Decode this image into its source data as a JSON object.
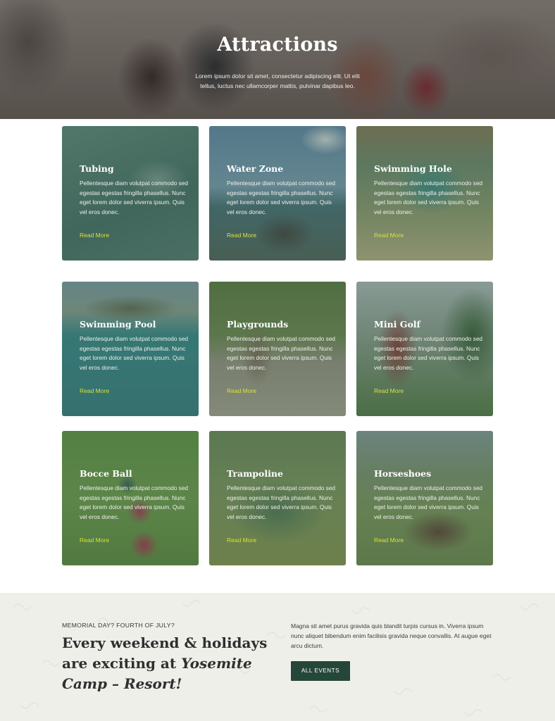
{
  "hero": {
    "title": "Attractions",
    "text": "Lorem ipsum dolor sit amet, consectetur adipiscing elit. Ut elit tellus, luctus nec ullamcorper mattis, pulvinar dapibus leo."
  },
  "cards": [
    {
      "title": "Tubing",
      "description": "Pellentesque diam volutpat commodo sed egestas egestas fringilla phasellus. Nunc eget lorem dolor sed viverra ipsum. Quis vel eros donec.",
      "link": "Read More"
    },
    {
      "title": "Water Zone",
      "description": "Pellentesque diam volutpat commodo sed egestas egestas fringilla phasellus. Nunc eget lorem dolor sed viverra ipsum. Quis vel eros donec.",
      "link": "Read More"
    },
    {
      "title": "Swimming Hole",
      "description": "Pellentesque diam volutpat commodo sed egestas egestas fringilla phasellus. Nunc eget lorem dolor sed viverra ipsum. Quis vel eros donec.",
      "link": "Read More"
    },
    {
      "title": "Swimming Pool",
      "description": "Pellentesque diam volutpat commodo sed egestas egestas fringilla phasellus. Nunc eget lorem dolor sed viverra ipsum. Quis vel eros donec.",
      "link": "Read More"
    },
    {
      "title": "Playgrounds",
      "description": "Pellentesque diam volutpat commodo sed egestas egestas fringilla phasellus. Nunc eget lorem dolor sed viverra ipsum. Quis vel eros donec.",
      "link": "Read More"
    },
    {
      "title": "Mini Golf",
      "description": "Pellentesque diam volutpat commodo sed egestas egestas fringilla phasellus. Nunc eget lorem dolor sed viverra ipsum. Quis vel eros donec.",
      "link": "Read More"
    },
    {
      "title": "Bocce Ball",
      "description": "Pellentesque diam volutpat commodo sed egestas egestas fringilla phasellus. Nunc eget lorem dolor sed viverra ipsum. Quis vel eros donec.",
      "link": "Read More"
    },
    {
      "title": "Trampoline",
      "description": "Pellentesque diam volutpat commodo sed egestas egestas fringilla phasellus. Nunc eget lorem dolor sed viverra ipsum. Quis vel eros donec.",
      "link": "Read More"
    },
    {
      "title": "Horseshoes",
      "description": "Pellentesque diam volutpat commodo sed egestas egestas fringilla phasellus. Nunc eget lorem dolor sed viverra ipsum. Quis vel eros donec.",
      "link": "Read More"
    }
  ],
  "events": {
    "eyebrow": "MEMORIAL DAY? FOURTH OF JULY?",
    "headline_plain": "Every weekend & holidays are exciting at ",
    "headline_italic": "Yosemite Camp – Resort!",
    "blurb": "Magna sit amet purus gravida quis blandit turpis cursus in. Viverra ipsum nunc aliquet bibendum enim facilisis gravida neque convallis. At augue eget arcu dictum.",
    "button_label": "ALL EVENTS"
  },
  "colors": {
    "accent_link": "#d8e23a",
    "button_bg": "#24473a",
    "band_bg": "#efefea"
  }
}
